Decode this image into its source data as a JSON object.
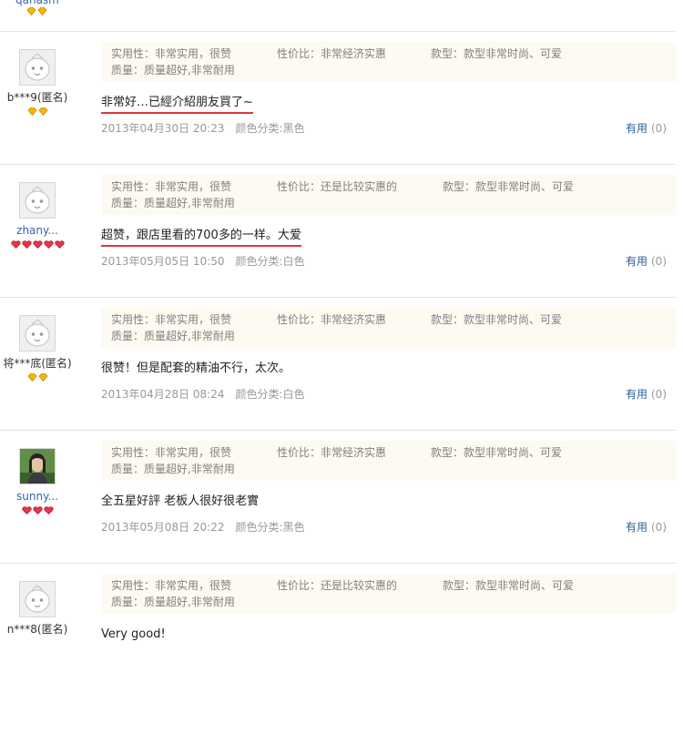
{
  "top_partial": {
    "username": "qanasm",
    "badge_type": "gold",
    "badge_count": 2
  },
  "colors": {
    "link_blue": "#2a5d9f",
    "attr_bg": "#fdfaf1",
    "underline_red": "#d93a3a",
    "divider": "#e3e3e3"
  },
  "reviews": [
    {
      "username": "b***9(匿名)",
      "username_is_link": false,
      "avatar": "default-avatar-icon",
      "badge_type": "gold",
      "badge_count": 2,
      "attrs": {
        "practical": "实用性：非常实用，很赞",
        "value": "性价比：非常经济实惠",
        "style": "款型：款型非常时尚、可爱",
        "quality": "质量：质量超好,非常耐用"
      },
      "text": "非常好…已經介紹朋友買了~",
      "underlined": true,
      "date": "2013年04月30日 20:23",
      "color_category": "颜色分类:黑色",
      "useful_label": "有用",
      "useful_count": "(0)"
    },
    {
      "username": "zhany...",
      "username_is_link": true,
      "avatar": "default-avatar-icon",
      "badge_type": "red",
      "badge_count": 5,
      "attrs": {
        "practical": "实用性：非常实用，很赞",
        "value": "性价比：还是比较实惠的",
        "style": "款型：款型非常时尚、可爱",
        "quality": "质量：质量超好,非常耐用"
      },
      "text": "超赞，跟店里看的700多的一样。大爱",
      "underlined": true,
      "date": "2013年05月05日 10:50",
      "color_category": "颜色分类:白色",
      "useful_label": "有用",
      "useful_count": "(0)"
    },
    {
      "username": "将***底(匿名)",
      "username_is_link": false,
      "avatar": "default-avatar-icon",
      "badge_type": "gold",
      "badge_count": 2,
      "attrs": {
        "practical": "实用性：非常实用，很赞",
        "value": "性价比：非常经济实惠",
        "style": "款型：款型非常时尚、可爱",
        "quality": "质量：质量超好,非常耐用"
      },
      "text": "很赞！但是配套的精油不行，太次。",
      "underlined": false,
      "date": "2013年04月28日 08:24",
      "color_category": "颜色分类:白色",
      "useful_label": "有用",
      "useful_count": "(0)"
    },
    {
      "username": "sunny...",
      "username_is_link": true,
      "avatar": "photo-avatar-icon",
      "badge_type": "red",
      "badge_count": 3,
      "attrs": {
        "practical": "实用性：非常实用，很赞",
        "value": "性价比：非常经济实惠",
        "style": "款型：款型非常时尚、可爱",
        "quality": "质量：质量超好,非常耐用"
      },
      "text": "全五星好評 老板人很好很老實",
      "underlined": false,
      "date": "2013年05月08日 20:22",
      "color_category": "颜色分类:黑色",
      "useful_label": "有用",
      "useful_count": "(0)"
    },
    {
      "username": "n***8(匿名)",
      "username_is_link": false,
      "avatar": "default-avatar-icon",
      "badge_type": "none",
      "badge_count": 0,
      "attrs": {
        "practical": "实用性：非常实用，很赞",
        "value": "性价比：还是比较实惠的",
        "style": "款型：款型非常时尚、可爱",
        "quality": "质量：质量超好,非常耐用"
      },
      "text": "Very good!",
      "underlined": false
    }
  ]
}
